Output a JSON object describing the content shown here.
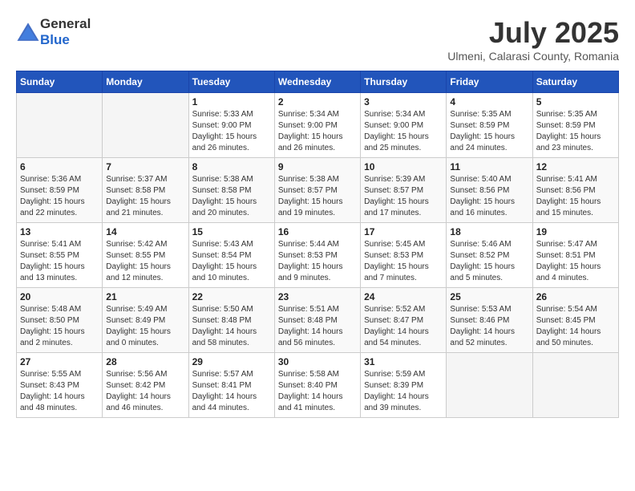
{
  "header": {
    "logo_general": "General",
    "logo_blue": "Blue",
    "month": "July 2025",
    "location": "Ulmeni, Calarasi County, Romania"
  },
  "days_of_week": [
    "Sunday",
    "Monday",
    "Tuesday",
    "Wednesday",
    "Thursday",
    "Friday",
    "Saturday"
  ],
  "weeks": [
    [
      {
        "day": "",
        "detail": ""
      },
      {
        "day": "",
        "detail": ""
      },
      {
        "day": "1",
        "detail": "Sunrise: 5:33 AM\nSunset: 9:00 PM\nDaylight: 15 hours\nand 26 minutes."
      },
      {
        "day": "2",
        "detail": "Sunrise: 5:34 AM\nSunset: 9:00 PM\nDaylight: 15 hours\nand 26 minutes."
      },
      {
        "day": "3",
        "detail": "Sunrise: 5:34 AM\nSunset: 9:00 PM\nDaylight: 15 hours\nand 25 minutes."
      },
      {
        "day": "4",
        "detail": "Sunrise: 5:35 AM\nSunset: 8:59 PM\nDaylight: 15 hours\nand 24 minutes."
      },
      {
        "day": "5",
        "detail": "Sunrise: 5:35 AM\nSunset: 8:59 PM\nDaylight: 15 hours\nand 23 minutes."
      }
    ],
    [
      {
        "day": "6",
        "detail": "Sunrise: 5:36 AM\nSunset: 8:59 PM\nDaylight: 15 hours\nand 22 minutes."
      },
      {
        "day": "7",
        "detail": "Sunrise: 5:37 AM\nSunset: 8:58 PM\nDaylight: 15 hours\nand 21 minutes."
      },
      {
        "day": "8",
        "detail": "Sunrise: 5:38 AM\nSunset: 8:58 PM\nDaylight: 15 hours\nand 20 minutes."
      },
      {
        "day": "9",
        "detail": "Sunrise: 5:38 AM\nSunset: 8:57 PM\nDaylight: 15 hours\nand 19 minutes."
      },
      {
        "day": "10",
        "detail": "Sunrise: 5:39 AM\nSunset: 8:57 PM\nDaylight: 15 hours\nand 17 minutes."
      },
      {
        "day": "11",
        "detail": "Sunrise: 5:40 AM\nSunset: 8:56 PM\nDaylight: 15 hours\nand 16 minutes."
      },
      {
        "day": "12",
        "detail": "Sunrise: 5:41 AM\nSunset: 8:56 PM\nDaylight: 15 hours\nand 15 minutes."
      }
    ],
    [
      {
        "day": "13",
        "detail": "Sunrise: 5:41 AM\nSunset: 8:55 PM\nDaylight: 15 hours\nand 13 minutes."
      },
      {
        "day": "14",
        "detail": "Sunrise: 5:42 AM\nSunset: 8:55 PM\nDaylight: 15 hours\nand 12 minutes."
      },
      {
        "day": "15",
        "detail": "Sunrise: 5:43 AM\nSunset: 8:54 PM\nDaylight: 15 hours\nand 10 minutes."
      },
      {
        "day": "16",
        "detail": "Sunrise: 5:44 AM\nSunset: 8:53 PM\nDaylight: 15 hours\nand 9 minutes."
      },
      {
        "day": "17",
        "detail": "Sunrise: 5:45 AM\nSunset: 8:53 PM\nDaylight: 15 hours\nand 7 minutes."
      },
      {
        "day": "18",
        "detail": "Sunrise: 5:46 AM\nSunset: 8:52 PM\nDaylight: 15 hours\nand 5 minutes."
      },
      {
        "day": "19",
        "detail": "Sunrise: 5:47 AM\nSunset: 8:51 PM\nDaylight: 15 hours\nand 4 minutes."
      }
    ],
    [
      {
        "day": "20",
        "detail": "Sunrise: 5:48 AM\nSunset: 8:50 PM\nDaylight: 15 hours\nand 2 minutes."
      },
      {
        "day": "21",
        "detail": "Sunrise: 5:49 AM\nSunset: 8:49 PM\nDaylight: 15 hours\nand 0 minutes."
      },
      {
        "day": "22",
        "detail": "Sunrise: 5:50 AM\nSunset: 8:48 PM\nDaylight: 14 hours\nand 58 minutes."
      },
      {
        "day": "23",
        "detail": "Sunrise: 5:51 AM\nSunset: 8:48 PM\nDaylight: 14 hours\nand 56 minutes."
      },
      {
        "day": "24",
        "detail": "Sunrise: 5:52 AM\nSunset: 8:47 PM\nDaylight: 14 hours\nand 54 minutes."
      },
      {
        "day": "25",
        "detail": "Sunrise: 5:53 AM\nSunset: 8:46 PM\nDaylight: 14 hours\nand 52 minutes."
      },
      {
        "day": "26",
        "detail": "Sunrise: 5:54 AM\nSunset: 8:45 PM\nDaylight: 14 hours\nand 50 minutes."
      }
    ],
    [
      {
        "day": "27",
        "detail": "Sunrise: 5:55 AM\nSunset: 8:43 PM\nDaylight: 14 hours\nand 48 minutes."
      },
      {
        "day": "28",
        "detail": "Sunrise: 5:56 AM\nSunset: 8:42 PM\nDaylight: 14 hours\nand 46 minutes."
      },
      {
        "day": "29",
        "detail": "Sunrise: 5:57 AM\nSunset: 8:41 PM\nDaylight: 14 hours\nand 44 minutes."
      },
      {
        "day": "30",
        "detail": "Sunrise: 5:58 AM\nSunset: 8:40 PM\nDaylight: 14 hours\nand 41 minutes."
      },
      {
        "day": "31",
        "detail": "Sunrise: 5:59 AM\nSunset: 8:39 PM\nDaylight: 14 hours\nand 39 minutes."
      },
      {
        "day": "",
        "detail": ""
      },
      {
        "day": "",
        "detail": ""
      }
    ]
  ]
}
